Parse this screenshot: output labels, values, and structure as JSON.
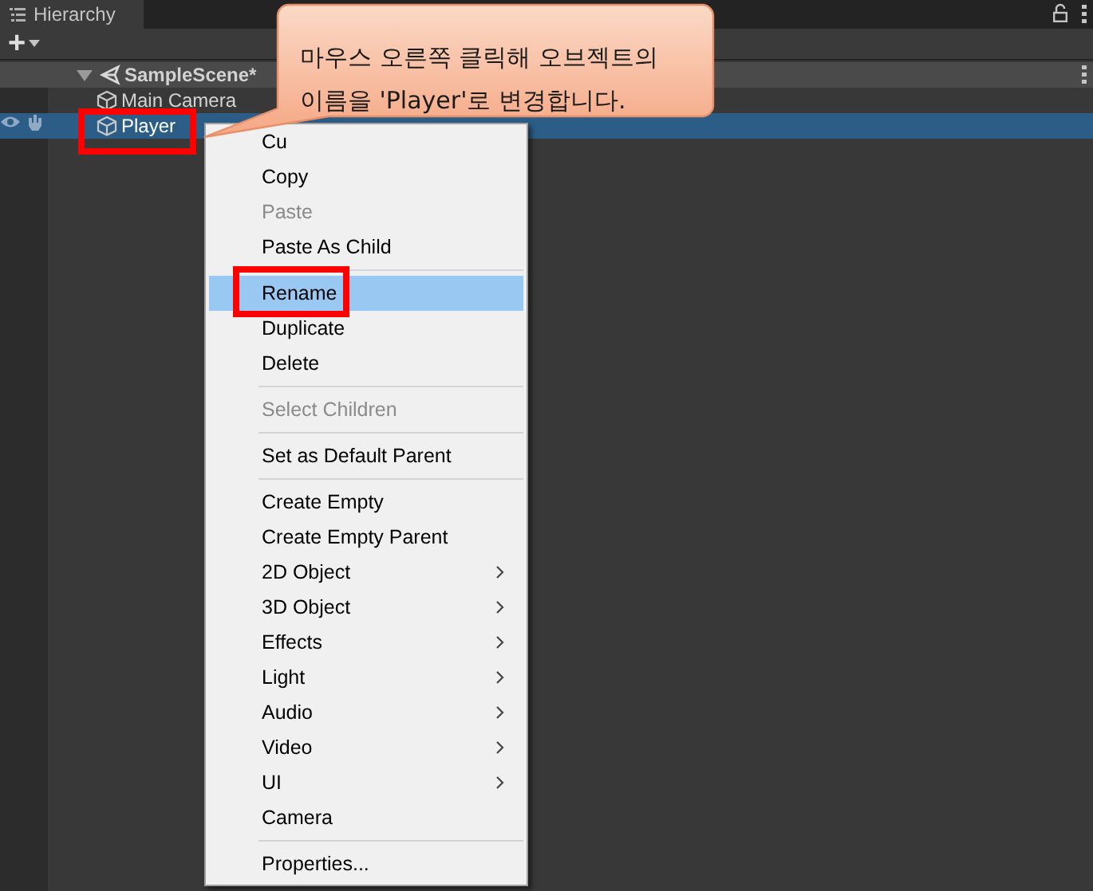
{
  "panel": {
    "title": "Hierarchy"
  },
  "toolbar": {
    "add": "+"
  },
  "tree": [
    {
      "label": "SampleScene*",
      "kind": "scene",
      "expanded": true,
      "selected": false,
      "highlighted": false,
      "children": [
        {
          "label": "Main Camera",
          "kind": "object",
          "selected": false,
          "highlighted": false
        },
        {
          "label": "Player",
          "kind": "object",
          "selected": true,
          "highlighted": true
        }
      ]
    }
  ],
  "context_menu": {
    "items": [
      {
        "kind": "item",
        "label": "Cu",
        "disabled": false,
        "selected": false,
        "submenu": false,
        "highlighted": false
      },
      {
        "kind": "item",
        "label": "Copy",
        "disabled": false,
        "selected": false,
        "submenu": false,
        "highlighted": false
      },
      {
        "kind": "item",
        "label": "Paste",
        "disabled": true,
        "selected": false,
        "submenu": false,
        "highlighted": false
      },
      {
        "kind": "item",
        "label": "Paste As Child",
        "disabled": false,
        "selected": false,
        "submenu": false,
        "highlighted": false
      },
      {
        "kind": "separator"
      },
      {
        "kind": "item",
        "label": "Rename",
        "disabled": false,
        "selected": true,
        "submenu": false,
        "highlighted": true
      },
      {
        "kind": "item",
        "label": "Duplicate",
        "disabled": false,
        "selected": false,
        "submenu": false,
        "highlighted": false
      },
      {
        "kind": "item",
        "label": "Delete",
        "disabled": false,
        "selected": false,
        "submenu": false,
        "highlighted": false
      },
      {
        "kind": "separator"
      },
      {
        "kind": "item",
        "label": "Select Children",
        "disabled": true,
        "selected": false,
        "submenu": false,
        "highlighted": false
      },
      {
        "kind": "separator"
      },
      {
        "kind": "item",
        "label": "Set as Default Parent",
        "disabled": false,
        "selected": false,
        "submenu": false,
        "highlighted": false
      },
      {
        "kind": "separator"
      },
      {
        "kind": "item",
        "label": "Create Empty",
        "disabled": false,
        "selected": false,
        "submenu": false,
        "highlighted": false
      },
      {
        "kind": "item",
        "label": "Create Empty Parent",
        "disabled": false,
        "selected": false,
        "submenu": false,
        "highlighted": false
      },
      {
        "kind": "item",
        "label": "2D Object",
        "disabled": false,
        "selected": false,
        "submenu": true,
        "highlighted": false
      },
      {
        "kind": "item",
        "label": "3D Object",
        "disabled": false,
        "selected": false,
        "submenu": true,
        "highlighted": false
      },
      {
        "kind": "item",
        "label": "Effects",
        "disabled": false,
        "selected": false,
        "submenu": true,
        "highlighted": false
      },
      {
        "kind": "item",
        "label": "Light",
        "disabled": false,
        "selected": false,
        "submenu": true,
        "highlighted": false
      },
      {
        "kind": "item",
        "label": "Audio",
        "disabled": false,
        "selected": false,
        "submenu": true,
        "highlighted": false
      },
      {
        "kind": "item",
        "label": "Video",
        "disabled": false,
        "selected": false,
        "submenu": true,
        "highlighted": false
      },
      {
        "kind": "item",
        "label": "UI",
        "disabled": false,
        "selected": false,
        "submenu": true,
        "highlighted": false
      },
      {
        "kind": "item",
        "label": "Camera",
        "disabled": false,
        "selected": false,
        "submenu": false,
        "highlighted": false
      },
      {
        "kind": "separator"
      },
      {
        "kind": "item",
        "label": "Properties...",
        "disabled": false,
        "selected": false,
        "submenu": false,
        "highlighted": false
      }
    ]
  },
  "callout": {
    "lines": [
      "마우스 오른쪽 클릭해 오브젝트의",
      "이름을 'Player'로 변경합니다."
    ]
  }
}
